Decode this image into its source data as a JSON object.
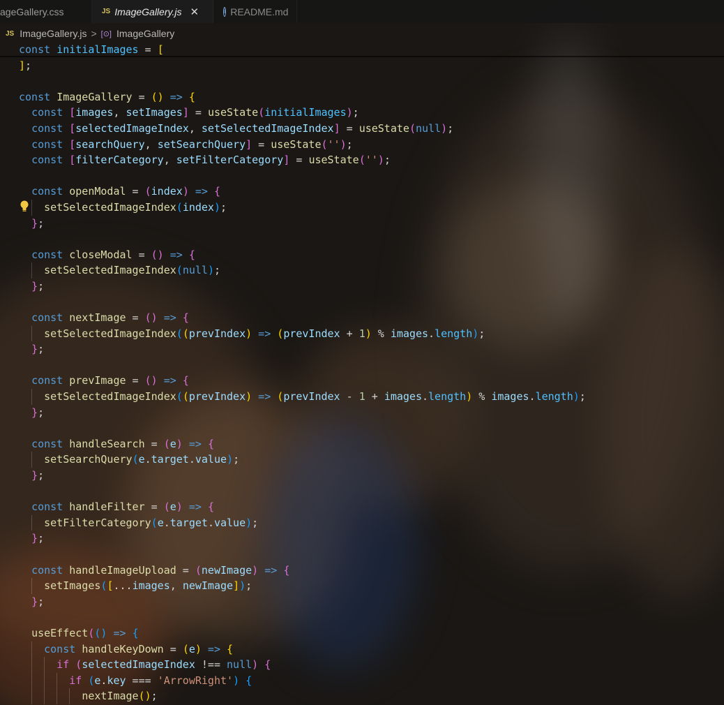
{
  "tabs": [
    {
      "label": "ageGallery.css",
      "active": false
    },
    {
      "label": "ImageGallery.js",
      "badge": "JS",
      "active": true
    },
    {
      "label": "README.md",
      "icon": "info-icon",
      "active": false
    }
  ],
  "breadcrumb": {
    "file": "ImageGallery.js",
    "file_badge": "JS",
    "symbol": "ImageGallery",
    "symbol_icon": "symbol-variable-icon"
  },
  "code_lines": [
    {
      "indent": 0,
      "tokens": [
        [
          "kw",
          "const "
        ],
        [
          "cst",
          "initialImages"
        ],
        [
          "op",
          " = "
        ],
        [
          "p1",
          "["
        ]
      ]
    },
    {
      "indent": 0,
      "tokens": [
        [
          "p1",
          "]"
        ],
        [
          "op",
          ";"
        ]
      ]
    },
    {
      "indent": 0,
      "tokens": []
    },
    {
      "indent": 0,
      "tokens": [
        [
          "kw",
          "const "
        ],
        [
          "fn",
          "ImageGallery"
        ],
        [
          "op",
          " = "
        ],
        [
          "p1",
          "()"
        ],
        [
          "arrow",
          " => "
        ],
        [
          "p1",
          "{"
        ]
      ]
    },
    {
      "indent": 1,
      "tokens": [
        [
          "kw",
          "const "
        ],
        [
          "p2",
          "["
        ],
        [
          "var",
          "images"
        ],
        [
          "op",
          ", "
        ],
        [
          "var",
          "setImages"
        ],
        [
          "p2",
          "]"
        ],
        [
          "op",
          " = "
        ],
        [
          "fn",
          "useState"
        ],
        [
          "p2",
          "("
        ],
        [
          "cst",
          "initialImages"
        ],
        [
          "p2",
          ")"
        ],
        [
          "op",
          ";"
        ]
      ]
    },
    {
      "indent": 1,
      "tokens": [
        [
          "kw",
          "const "
        ],
        [
          "p2",
          "["
        ],
        [
          "var",
          "selectedImageIndex"
        ],
        [
          "op",
          ", "
        ],
        [
          "var",
          "setSelectedImageIndex"
        ],
        [
          "p2",
          "]"
        ],
        [
          "op",
          " = "
        ],
        [
          "fn",
          "useState"
        ],
        [
          "p2",
          "("
        ],
        [
          "kw",
          "null"
        ],
        [
          "p2",
          ")"
        ],
        [
          "op",
          ";"
        ]
      ]
    },
    {
      "indent": 1,
      "tokens": [
        [
          "kw",
          "const "
        ],
        [
          "p2",
          "["
        ],
        [
          "var",
          "searchQuery"
        ],
        [
          "op",
          ", "
        ],
        [
          "var",
          "setSearchQuery"
        ],
        [
          "p2",
          "]"
        ],
        [
          "op",
          " = "
        ],
        [
          "fn",
          "useState"
        ],
        [
          "p2",
          "("
        ],
        [
          "str",
          "''"
        ],
        [
          "p2",
          ")"
        ],
        [
          "op",
          ";"
        ]
      ]
    },
    {
      "indent": 1,
      "tokens": [
        [
          "kw",
          "const "
        ],
        [
          "p2",
          "["
        ],
        [
          "var",
          "filterCategory"
        ],
        [
          "op",
          ", "
        ],
        [
          "var",
          "setFilterCategory"
        ],
        [
          "p2",
          "]"
        ],
        [
          "op",
          " = "
        ],
        [
          "fn",
          "useState"
        ],
        [
          "p2",
          "("
        ],
        [
          "str",
          "''"
        ],
        [
          "p2",
          ")"
        ],
        [
          "op",
          ";"
        ]
      ]
    },
    {
      "indent": 0,
      "tokens": []
    },
    {
      "indent": 1,
      "tokens": [
        [
          "kw",
          "const "
        ],
        [
          "fn",
          "openModal"
        ],
        [
          "op",
          " = "
        ],
        [
          "p2",
          "("
        ],
        [
          "var",
          "index"
        ],
        [
          "p2",
          ")"
        ],
        [
          "arrow",
          " => "
        ],
        [
          "p2",
          "{"
        ]
      ]
    },
    {
      "indent": 2,
      "tokens": [
        [
          "fn",
          "setSelectedImageIndex"
        ],
        [
          "p3",
          "("
        ],
        [
          "var",
          "index"
        ],
        [
          "p3",
          ")"
        ],
        [
          "op",
          ";"
        ]
      ]
    },
    {
      "indent": 1,
      "tokens": [
        [
          "p2",
          "}"
        ],
        [
          "op",
          ";"
        ]
      ]
    },
    {
      "indent": 0,
      "tokens": []
    },
    {
      "indent": 1,
      "tokens": [
        [
          "kw",
          "const "
        ],
        [
          "fn",
          "closeModal"
        ],
        [
          "op",
          " = "
        ],
        [
          "p2",
          "()"
        ],
        [
          "arrow",
          " => "
        ],
        [
          "p2",
          "{"
        ]
      ]
    },
    {
      "indent": 2,
      "tokens": [
        [
          "fn",
          "setSelectedImageIndex"
        ],
        [
          "p3",
          "("
        ],
        [
          "kw",
          "null"
        ],
        [
          "p3",
          ")"
        ],
        [
          "op",
          ";"
        ]
      ]
    },
    {
      "indent": 1,
      "tokens": [
        [
          "p2",
          "}"
        ],
        [
          "op",
          ";"
        ]
      ]
    },
    {
      "indent": 0,
      "tokens": []
    },
    {
      "indent": 1,
      "tokens": [
        [
          "kw",
          "const "
        ],
        [
          "fn",
          "nextImage"
        ],
        [
          "op",
          " = "
        ],
        [
          "p2",
          "()"
        ],
        [
          "arrow",
          " => "
        ],
        [
          "p2",
          "{"
        ]
      ]
    },
    {
      "indent": 2,
      "tokens": [
        [
          "fn",
          "setSelectedImageIndex"
        ],
        [
          "p3",
          "("
        ],
        [
          "p1",
          "("
        ],
        [
          "var",
          "prevIndex"
        ],
        [
          "p1",
          ")"
        ],
        [
          "arrow",
          " => "
        ],
        [
          "p1",
          "("
        ],
        [
          "var",
          "prevIndex"
        ],
        [
          "op",
          " + "
        ],
        [
          "num",
          "1"
        ],
        [
          "p1",
          ")"
        ],
        [
          "op",
          " % "
        ],
        [
          "var",
          "images"
        ],
        [
          "op",
          "."
        ],
        [
          "cst",
          "length"
        ],
        [
          "p3",
          ")"
        ],
        [
          "op",
          ";"
        ]
      ]
    },
    {
      "indent": 1,
      "tokens": [
        [
          "p2",
          "}"
        ],
        [
          "op",
          ";"
        ]
      ]
    },
    {
      "indent": 0,
      "tokens": []
    },
    {
      "indent": 1,
      "tokens": [
        [
          "kw",
          "const "
        ],
        [
          "fn",
          "prevImage"
        ],
        [
          "op",
          " = "
        ],
        [
          "p2",
          "()"
        ],
        [
          "arrow",
          " => "
        ],
        [
          "p2",
          "{"
        ]
      ]
    },
    {
      "indent": 2,
      "tokens": [
        [
          "fn",
          "setSelectedImageIndex"
        ],
        [
          "p3",
          "("
        ],
        [
          "p1",
          "("
        ],
        [
          "var",
          "prevIndex"
        ],
        [
          "p1",
          ")"
        ],
        [
          "arrow",
          " => "
        ],
        [
          "p1",
          "("
        ],
        [
          "var",
          "prevIndex"
        ],
        [
          "op",
          " - "
        ],
        [
          "num",
          "1"
        ],
        [
          "op",
          " + "
        ],
        [
          "var",
          "images"
        ],
        [
          "op",
          "."
        ],
        [
          "cst",
          "length"
        ],
        [
          "p1",
          ")"
        ],
        [
          "op",
          " % "
        ],
        [
          "var",
          "images"
        ],
        [
          "op",
          "."
        ],
        [
          "cst",
          "length"
        ],
        [
          "p3",
          ")"
        ],
        [
          "op",
          ";"
        ]
      ]
    },
    {
      "indent": 1,
      "tokens": [
        [
          "p2",
          "}"
        ],
        [
          "op",
          ";"
        ]
      ]
    },
    {
      "indent": 0,
      "tokens": []
    },
    {
      "indent": 1,
      "tokens": [
        [
          "kw",
          "const "
        ],
        [
          "fn",
          "handleSearch"
        ],
        [
          "op",
          " = "
        ],
        [
          "p2",
          "("
        ],
        [
          "var",
          "e"
        ],
        [
          "p2",
          ")"
        ],
        [
          "arrow",
          " => "
        ],
        [
          "p2",
          "{"
        ]
      ]
    },
    {
      "indent": 2,
      "tokens": [
        [
          "fn",
          "setSearchQuery"
        ],
        [
          "p3",
          "("
        ],
        [
          "var",
          "e"
        ],
        [
          "op",
          "."
        ],
        [
          "var",
          "target"
        ],
        [
          "op",
          "."
        ],
        [
          "var",
          "value"
        ],
        [
          "p3",
          ")"
        ],
        [
          "op",
          ";"
        ]
      ]
    },
    {
      "indent": 1,
      "tokens": [
        [
          "p2",
          "}"
        ],
        [
          "op",
          ";"
        ]
      ]
    },
    {
      "indent": 0,
      "tokens": []
    },
    {
      "indent": 1,
      "tokens": [
        [
          "kw",
          "const "
        ],
        [
          "fn",
          "handleFilter"
        ],
        [
          "op",
          " = "
        ],
        [
          "p2",
          "("
        ],
        [
          "var",
          "e"
        ],
        [
          "p2",
          ")"
        ],
        [
          "arrow",
          " => "
        ],
        [
          "p2",
          "{"
        ]
      ]
    },
    {
      "indent": 2,
      "tokens": [
        [
          "fn",
          "setFilterCategory"
        ],
        [
          "p3",
          "("
        ],
        [
          "var",
          "e"
        ],
        [
          "op",
          "."
        ],
        [
          "var",
          "target"
        ],
        [
          "op",
          "."
        ],
        [
          "var",
          "value"
        ],
        [
          "p3",
          ")"
        ],
        [
          "op",
          ";"
        ]
      ]
    },
    {
      "indent": 1,
      "tokens": [
        [
          "p2",
          "}"
        ],
        [
          "op",
          ";"
        ]
      ]
    },
    {
      "indent": 0,
      "tokens": []
    },
    {
      "indent": 1,
      "tokens": [
        [
          "kw",
          "const "
        ],
        [
          "fn",
          "handleImageUpload"
        ],
        [
          "op",
          " = "
        ],
        [
          "p2",
          "("
        ],
        [
          "var",
          "newImage"
        ],
        [
          "p2",
          ")"
        ],
        [
          "arrow",
          " => "
        ],
        [
          "p2",
          "{"
        ]
      ]
    },
    {
      "indent": 2,
      "tokens": [
        [
          "fn",
          "setImages"
        ],
        [
          "p3",
          "("
        ],
        [
          "p1",
          "["
        ],
        [
          "op",
          "..."
        ],
        [
          "var",
          "images"
        ],
        [
          "op",
          ", "
        ],
        [
          "var",
          "newImage"
        ],
        [
          "p1",
          "]"
        ],
        [
          "p3",
          ")"
        ],
        [
          "op",
          ";"
        ]
      ]
    },
    {
      "indent": 1,
      "tokens": [
        [
          "p2",
          "}"
        ],
        [
          "op",
          ";"
        ]
      ]
    },
    {
      "indent": 0,
      "tokens": []
    },
    {
      "indent": 1,
      "tokens": [
        [
          "fn",
          "useEffect"
        ],
        [
          "p2",
          "("
        ],
        [
          "p3",
          "()"
        ],
        [
          "arrow",
          " => "
        ],
        [
          "p3",
          "{"
        ]
      ]
    },
    {
      "indent": 2,
      "tokens": [
        [
          "kw",
          "const "
        ],
        [
          "fn",
          "handleKeyDown"
        ],
        [
          "op",
          " = "
        ],
        [
          "p1",
          "("
        ],
        [
          "var",
          "e"
        ],
        [
          "p1",
          ")"
        ],
        [
          "arrow",
          " => "
        ],
        [
          "p1",
          "{"
        ]
      ]
    },
    {
      "indent": 3,
      "tokens": [
        [
          "p2",
          "if "
        ],
        [
          "p2",
          "("
        ],
        [
          "var",
          "selectedImageIndex"
        ],
        [
          "op",
          " !== "
        ],
        [
          "kw",
          "null"
        ],
        [
          "p2",
          ")"
        ],
        [
          "op",
          " "
        ],
        [
          "p2",
          "{"
        ]
      ]
    },
    {
      "indent": 4,
      "tokens": [
        [
          "p2",
          "if "
        ],
        [
          "p3",
          "("
        ],
        [
          "var",
          "e"
        ],
        [
          "op",
          "."
        ],
        [
          "var",
          "key"
        ],
        [
          "op",
          " === "
        ],
        [
          "str",
          "'ArrowRight'"
        ],
        [
          "p3",
          ")"
        ],
        [
          "op",
          " "
        ],
        [
          "p3",
          "{"
        ]
      ]
    },
    {
      "indent": 5,
      "tokens": [
        [
          "fn",
          "nextImage"
        ],
        [
          "p1",
          "()"
        ],
        [
          "op",
          ";"
        ]
      ]
    }
  ]
}
